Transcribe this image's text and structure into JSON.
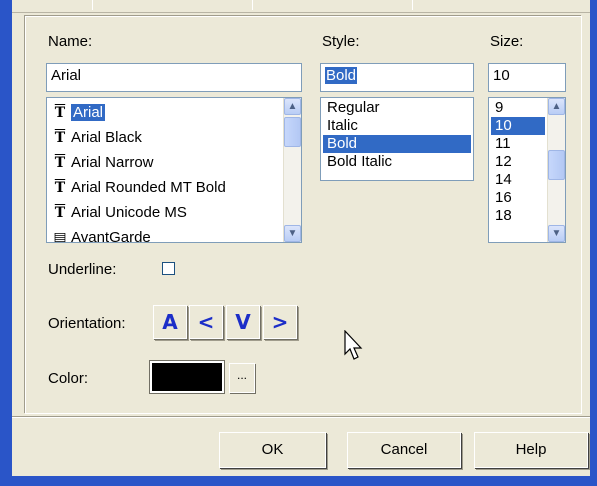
{
  "labels": {
    "name": "Name:",
    "style": "Style:",
    "size": "Size:",
    "underline": "Underline:",
    "orientation": "Orientation:",
    "color": "Color:"
  },
  "name_field": {
    "value": "Arial"
  },
  "style_field": {
    "value": "Bold"
  },
  "size_field": {
    "value": "10"
  },
  "font_list": [
    "Arial",
    "Arial Black",
    "Arial Narrow",
    "Arial Rounded MT Bold",
    "Arial Unicode MS",
    "AvantGarde"
  ],
  "font_list_selected": "Arial",
  "font_icons": [
    "truetype-icon",
    "truetype-icon",
    "truetype-icon",
    "truetype-icon",
    "truetype-icon",
    "printer-font-icon"
  ],
  "style_list": [
    "Regular",
    "Italic",
    "Bold",
    "Bold Italic"
  ],
  "style_list_selected": "Bold",
  "size_list": [
    "9",
    "10",
    "11",
    "12",
    "14",
    "16",
    "18"
  ],
  "size_list_selected": "10",
  "underline_checked": false,
  "orientation_buttons": [
    "A",
    "<",
    "V",
    ">"
  ],
  "color": {
    "value": "#000000",
    "more_label": "..."
  },
  "buttons": {
    "ok": "OK",
    "cancel": "Cancel",
    "help": "Help"
  },
  "colors": {
    "selection": "#316ac5",
    "frame": "#2a55c8",
    "dialog_bg": "#ece9d8",
    "orientation_glyph": "#1c2ec8"
  }
}
